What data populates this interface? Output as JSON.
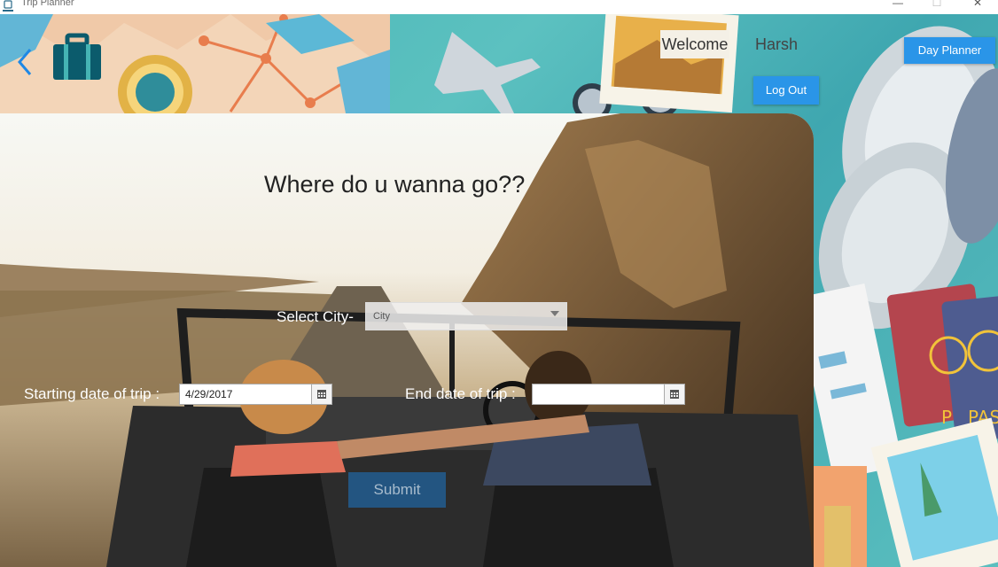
{
  "window": {
    "title": "Trip Planner",
    "controls": [
      "minimize",
      "maximize",
      "close"
    ],
    "minimize_glyph": "—",
    "maximize_glyph": "☐",
    "close_glyph": "✕"
  },
  "header": {
    "welcome_label": "Welcome",
    "username": "Harsh",
    "day_planner_label": "Day Planner",
    "logout_label": "Log Out"
  },
  "form": {
    "heading": "Where do u wanna go??",
    "city_label": "Select City-",
    "city_value": "City",
    "start_label": "Starting date of trip :",
    "start_value": "4/29/2017",
    "end_label": "End date of trip :",
    "end_value": "",
    "submit_label": "Submit"
  },
  "icons": {
    "back": "chevron-left-icon",
    "suitcase": "suitcase-icon",
    "calendar": "calendar-icon"
  },
  "colors": {
    "accent_blue": "#2a95e8",
    "teal_bg": "#45b4b4",
    "welcome_bg": "#f4f0e6"
  }
}
